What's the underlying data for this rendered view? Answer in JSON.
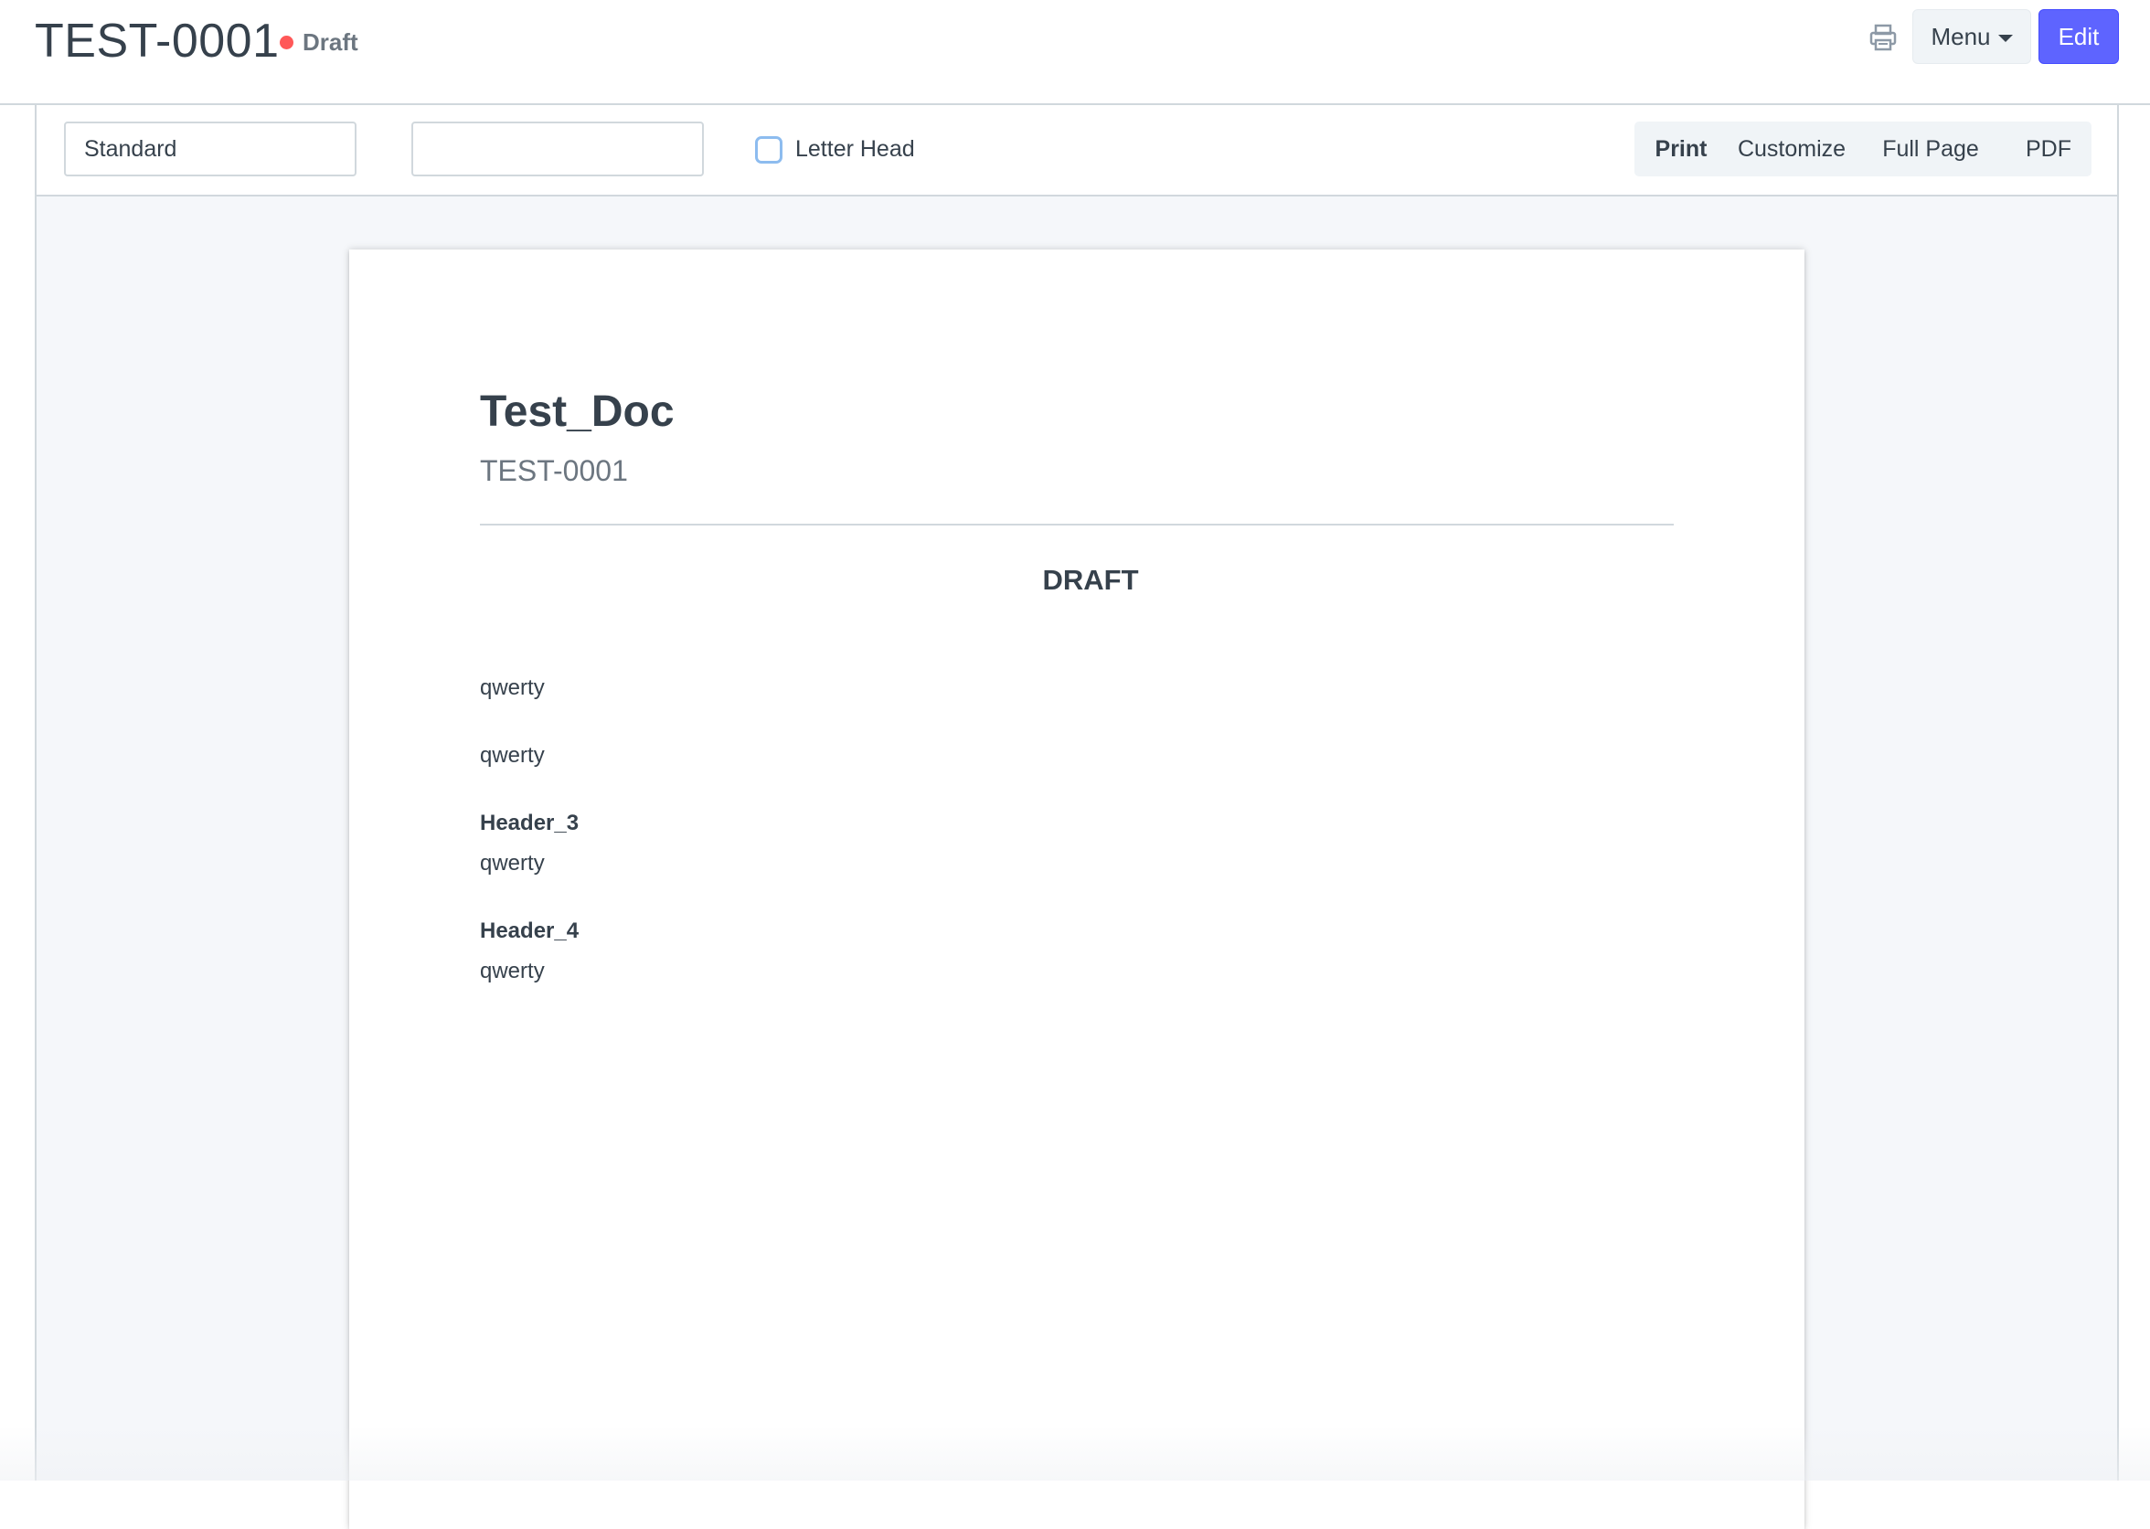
{
  "header": {
    "title": "TEST-0001",
    "status": "Draft",
    "status_color": "#ff5858",
    "print_icon": "printer-icon",
    "menu_label": "Menu",
    "edit_label": "Edit",
    "accent": "#5e64ff"
  },
  "toolbar": {
    "print_format": "Standard",
    "language": "",
    "letter_head_label": "Letter Head",
    "letter_head_checked": false,
    "buttons": {
      "print": "Print",
      "customize": "Customize",
      "full_page": "Full Page",
      "pdf": "PDF"
    }
  },
  "sheet": {
    "title": "Test_Doc",
    "subtitle": "TEST-0001",
    "watermark": "DRAFT",
    "fields": [
      {
        "label": "",
        "value": "qwerty"
      },
      {
        "label": "",
        "value": "qwerty"
      },
      {
        "label": "Header_3",
        "value": "qwerty"
      },
      {
        "label": "Header_4",
        "value": "qwerty"
      }
    ]
  }
}
